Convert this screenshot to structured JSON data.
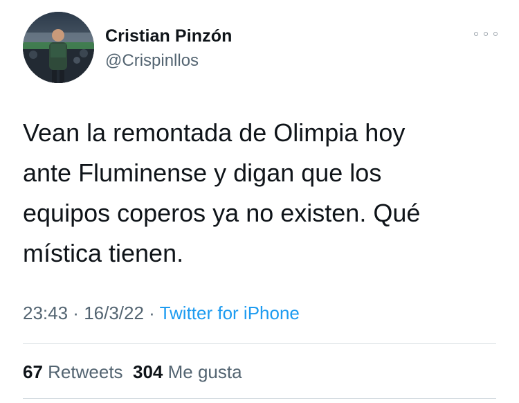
{
  "user": {
    "display_name": "Cristian Pinzón",
    "handle": "@Crispinllos"
  },
  "icons": {
    "more": "more-horizontal-icon"
  },
  "tweet": {
    "text": "Vean la remontada de Olimpia hoy\nante Fluminense y digan que los\nequipos coperos ya no existen. Qué\nmística tienen."
  },
  "meta": {
    "time": "23:43",
    "separator_1": " · ",
    "date": "16/3/22",
    "separator_2": " · ",
    "source": "Twitter for iPhone"
  },
  "stats": {
    "retweets_count": "67",
    "retweets_label": "Retweets",
    "likes_count": "304",
    "likes_label": "Me gusta"
  },
  "colors": {
    "text_primary": "#0f1419",
    "text_secondary": "#536471",
    "link": "#1d9bf0",
    "divider": "#d6dde2"
  }
}
